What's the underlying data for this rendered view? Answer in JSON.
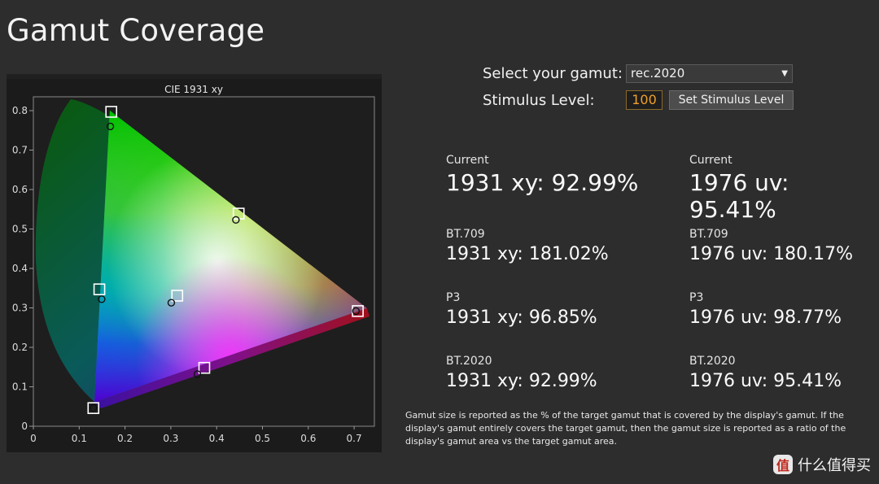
{
  "page": {
    "title": "Gamut Coverage"
  },
  "controls": {
    "gamut_label": "Select your gamut:",
    "gamut_value": "rec.2020",
    "stimulus_label": "Stimulus Level:",
    "stimulus_value": "100",
    "set_button": "Set Stimulus Level"
  },
  "stats": {
    "current": {
      "xy_label": "Current",
      "xy_value": "1931 xy: 92.99%",
      "uv_label": "Current",
      "uv_value": "1976 uv: 95.41%"
    },
    "bt709": {
      "xy_label": "BT.709",
      "xy_value": "1931 xy: 181.02%",
      "uv_label": "BT.709",
      "uv_value": "1976 uv: 180.17%"
    },
    "p3": {
      "xy_label": "P3",
      "xy_value": "1931 xy: 96.85%",
      "uv_label": "P3",
      "uv_value": "1976 uv: 98.77%"
    },
    "bt2020": {
      "xy_label": "BT.2020",
      "xy_value": "1931 xy: 92.99%",
      "uv_label": "BT.2020",
      "uv_value": "1976 uv: 95.41%"
    }
  },
  "footnote": "Gamut size is reported as the % of the target gamut that is covered by the display's gamut. If the display's gamut entirely covers the target gamut, then the gamut size is reported as a ratio of the display's gamut area vs the target gamut area.",
  "watermark": {
    "badge": "值",
    "text": "什么值得买"
  },
  "chart_data": {
    "type": "scatter",
    "title": "CIE 1931 xy",
    "xlim": [
      0,
      0.72
    ],
    "ylim": [
      0,
      0.82
    ],
    "x_ticks": [
      "0",
      "0.1",
      "0.2",
      "0.3",
      "0.4",
      "0.5",
      "0.6",
      "0.7"
    ],
    "y_ticks": [
      "0",
      "0.1",
      "0.2",
      "0.3",
      "0.4",
      "0.5",
      "0.6",
      "0.7",
      "0.8"
    ],
    "series": [
      {
        "marker": "square",
        "points": [
          {
            "x": 0.17,
            "y": 0.797
          },
          {
            "x": 0.708,
            "y": 0.292
          },
          {
            "x": 0.131,
            "y": 0.046
          },
          {
            "x": 0.144,
            "y": 0.347
          },
          {
            "x": 0.448,
            "y": 0.539
          },
          {
            "x": 0.373,
            "y": 0.148
          },
          {
            "x": 0.314,
            "y": 0.331
          }
        ]
      },
      {
        "marker": "circle",
        "points": [
          {
            "x": 0.168,
            "y": 0.76
          },
          {
            "x": 0.704,
            "y": 0.292
          },
          {
            "x": 0.131,
            "y": 0.046
          },
          {
            "x": 0.149,
            "y": 0.322
          },
          {
            "x": 0.442,
            "y": 0.523
          },
          {
            "x": 0.358,
            "y": 0.132
          },
          {
            "x": 0.301,
            "y": 0.313
          }
        ]
      }
    ],
    "grid": false
  }
}
